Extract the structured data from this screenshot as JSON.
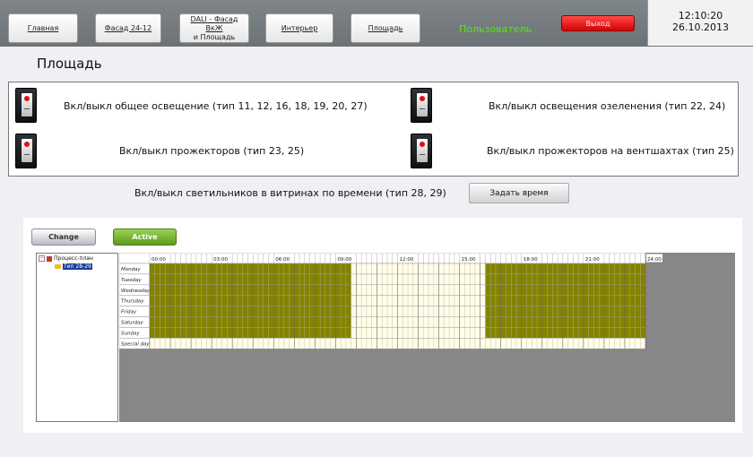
{
  "nav": {
    "tabs": [
      {
        "label": "Главная"
      },
      {
        "label": "Фасад 24-12"
      },
      {
        "label_line1": "DALI - Фасад ВкЖ",
        "label_line2": "и Площадь"
      },
      {
        "label": "Интерьер"
      },
      {
        "label": "Площадь"
      }
    ],
    "user": "Пользователь",
    "exit": "Выход",
    "time": "12:10:20",
    "date": "26.10.2013"
  },
  "colors": {
    "user_text": "#4cf000",
    "exit_button": "#e01010",
    "schedule_active": "#838300",
    "schedule_empty": "#fffde8"
  },
  "page": {
    "title": "Площадь"
  },
  "switches": [
    {
      "label": "Вкл/выкл общее освещение (тип 11, 12, 16, 18, 19, 20, 27)",
      "icon": "light-switch-icon"
    },
    {
      "label": "Вкл/выкл освещения озеленения (тип 22, 24)",
      "icon": "light-switch-icon"
    },
    {
      "label": "Вкл/выкл прожекторов (тип 23, 25)",
      "icon": "light-switch-icon"
    },
    {
      "label": "Вкл/выкл прожекторов на вентшахтах (тип 25)",
      "icon": "light-switch-icon"
    }
  ],
  "vitrines": {
    "label": "Вкл/выкл светильников в витринах по времени (тип 28, 29)",
    "set_time_button": "Задать время"
  },
  "scheduler": {
    "change_label": "Change",
    "active_label": "Active",
    "tree_root": "Процесс-план",
    "tree_child": "Тип 28-29",
    "hour_labels": [
      "00:00",
      "03:00",
      "06:00",
      "09:00",
      "12:00",
      "15:00",
      "18:00",
      "21:00",
      "24:00"
    ],
    "days": [
      "Monday",
      "Tuesday",
      "Wednesday",
      "Thursday",
      "Friday",
      "Saturday",
      "Sunday",
      "Special day"
    ],
    "active_periods": [
      {
        "from": "00:00",
        "to": "09:45",
        "days": [
          "Monday",
          "Tuesday",
          "Wednesday",
          "Thursday",
          "Friday",
          "Saturday",
          "Sunday"
        ]
      },
      {
        "from": "16:15",
        "to": "24:00",
        "days": [
          "Monday",
          "Tuesday",
          "Wednesday",
          "Thursday",
          "Friday",
          "Saturday",
          "Sunday"
        ]
      }
    ]
  }
}
